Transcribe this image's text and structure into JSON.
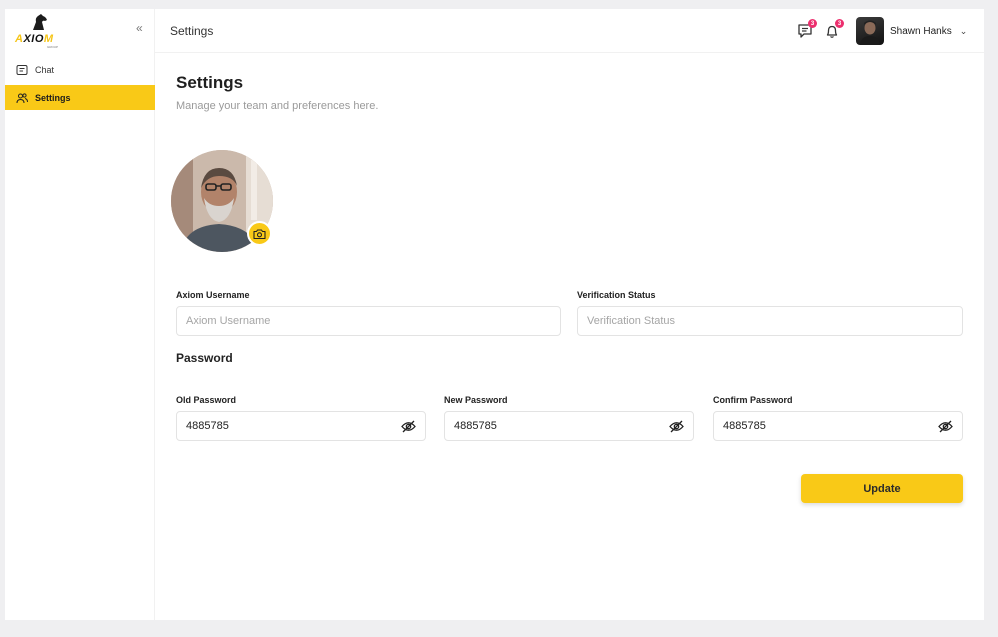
{
  "brand": {
    "logo_text_a": "A",
    "logo_text_b": "XIO",
    "logo_text_c": "M",
    "logo_sub": "GROUP",
    "accent": "#f9c917"
  },
  "sidebar": {
    "collapse_icon": "double-chevron-left-icon",
    "items": [
      {
        "label": "Chat",
        "icon": "chat-icon",
        "active": false
      },
      {
        "label": "Settings",
        "icon": "users-icon",
        "active": true
      }
    ]
  },
  "header": {
    "title": "Settings",
    "messages_badge": "3",
    "notifications_badge": "3",
    "user_name": "Shawn Hanks"
  },
  "main": {
    "title": "Settings",
    "subtitle": "Manage your team and preferences here.",
    "username_label": "Axiom Username",
    "username_placeholder": "Axiom Username",
    "verification_label": "Verification Status",
    "verification_placeholder": "Verification Status",
    "password_section": "Password",
    "old_password_label": "Old Password",
    "old_password_value": "4885785",
    "new_password_label": "New Password",
    "new_password_value": "4885785",
    "confirm_password_label": "Confirm Password",
    "confirm_password_value": "4885785",
    "update_label": "Update"
  }
}
